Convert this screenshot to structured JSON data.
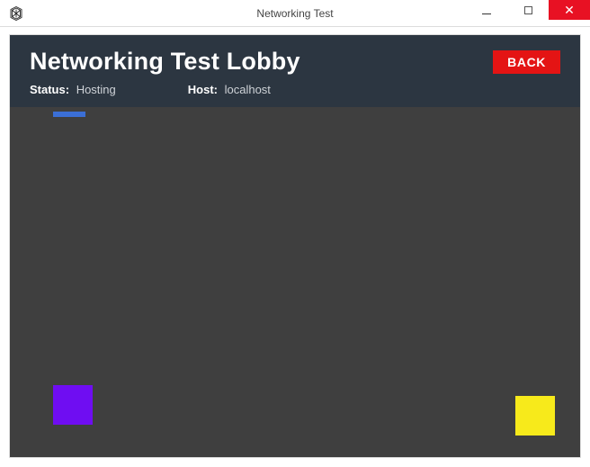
{
  "window": {
    "title": "Networking Test"
  },
  "lobby": {
    "title": "Networking Test Lobby",
    "back_label": "BACK",
    "status_label": "Status:",
    "status_value": "Hosting",
    "host_label": "Host:",
    "host_value": "localhost"
  },
  "players": {
    "blue": {
      "color": "#3b6fd6"
    },
    "purple": {
      "color": "#6f0df2"
    },
    "yellow": {
      "color": "#f7ea1b"
    }
  }
}
